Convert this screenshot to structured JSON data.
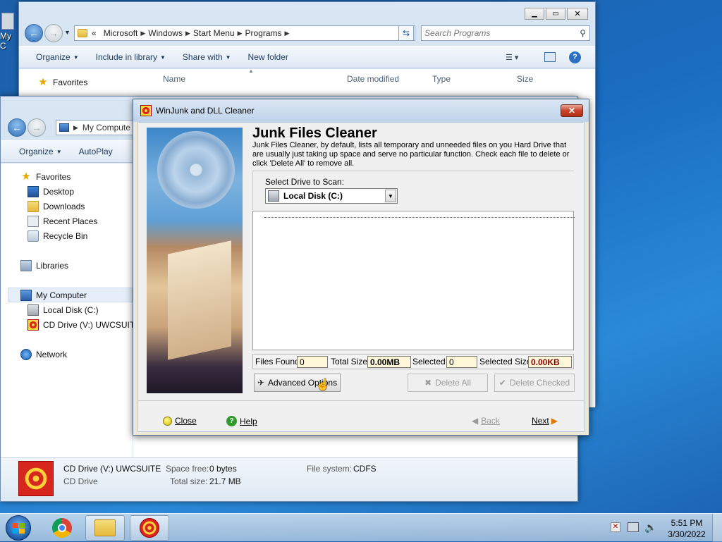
{
  "desktop": {
    "icon_label": "My C"
  },
  "explorer_back": {
    "breadcrumb": [
      "Microsoft",
      "Windows",
      "Start Menu",
      "Programs"
    ],
    "breadcrumb_prefix": "«",
    "search_placeholder": "Search Programs",
    "toolbar": {
      "organize": "Organize",
      "include": "Include in library",
      "share": "Share with",
      "new_folder": "New folder"
    },
    "favorites": "Favorites",
    "columns": {
      "name": "Name",
      "date": "Date modified",
      "type": "Type",
      "size": "Size"
    }
  },
  "explorer_front": {
    "address": "My Compute",
    "toolbar": {
      "organize": "Organize",
      "autoplay": "AutoPlay"
    },
    "nav": {
      "favorites": "Favorites",
      "desktop": "Desktop",
      "downloads": "Downloads",
      "recent": "Recent Places",
      "recycle": "Recycle Bin",
      "libraries": "Libraries",
      "computer": "My Computer",
      "local_disk": "Local Disk (C:)",
      "cd_drive": "CD Drive (V:) UWCSUITE",
      "network": "Network"
    },
    "details": {
      "name": "CD Drive (V:) UWCSUITE",
      "kind": "CD Drive",
      "space_free_label": "Space free:",
      "space_free": "0 bytes",
      "total_size_label": "Total size:",
      "total_size": "21.7 MB",
      "fs_label": "File system:",
      "fs": "CDFS"
    }
  },
  "dialog": {
    "title": "WinJunk and DLL Cleaner",
    "heading": "Junk Files Cleaner",
    "description": "Junk Files Cleaner, by default, lists all temporary and unneeded files on you Hard Drive that are usually just taking up space and serve no particular function. Check each file to delete or click 'Delete All' to remove all.",
    "drive_label": "Select Drive to Scan:",
    "drive_value": "Local Disk (C:)",
    "stats": {
      "files_found_label": "Files Found:",
      "files_found": "0",
      "total_size_label": "Total Size:",
      "total_size": "0.00MB",
      "selected_label": "Selected:",
      "selected": "0",
      "selected_size_label": "Selected Size:",
      "selected_size": "0.00KB"
    },
    "buttons": {
      "advanced": "Advanced Options",
      "delete_all": "Delete All",
      "delete_checked": "Delete Checked",
      "close": "Close",
      "help": "Help",
      "back": "Back",
      "next": "Next"
    }
  },
  "taskbar": {
    "time": "5:51 PM",
    "date": "3/30/2022"
  }
}
